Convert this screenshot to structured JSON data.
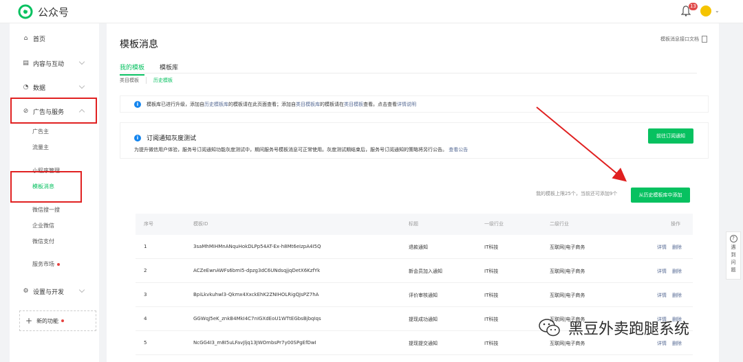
{
  "topbar": {
    "app_name": "公众号",
    "bell_badge": "13"
  },
  "sidebar": {
    "items": [
      {
        "label": "首页",
        "icon": "home-icon"
      },
      {
        "label": "内容与互动",
        "icon": "document-icon"
      },
      {
        "label": "数据",
        "icon": "chart-icon"
      },
      {
        "label": "广告与服务",
        "icon": "compass-icon"
      },
      {
        "label": "设置与开发",
        "icon": "gear-icon"
      }
    ],
    "sub_items": {
      "ad": [
        "广告主",
        "流量主"
      ],
      "service": [
        "小程序管理",
        "模板消息",
        "微信搜一搜",
        "企业微信",
        "微信支付"
      ],
      "market": "服务市场"
    },
    "new_feature": "新的功能"
  },
  "main": {
    "title": "模板消息",
    "doc_link": "模板消息接口文档",
    "tabs": [
      "我的模板",
      "模板库"
    ],
    "subtabs": [
      "类目模板",
      "历史模板"
    ],
    "notice1": {
      "t1": "模板库已进行升级，添加自",
      "l1": "历史模板库",
      "t2": "的模板请在此页面查看；添加自",
      "l2": "类目模板库",
      "t3": "的模板请在",
      "l3": "类目模板",
      "t4": "查看。点击查看",
      "l4": "详情说明"
    },
    "notice2": {
      "title": "订阅通知灰度测试",
      "desc": "为提升微信用户体验，服务号订阅通知功能灰度测试中，期间服务号模板消息可正常使用。灰度测试期结束后，服务号订阅通知的策略将另行公告。",
      "link": "查看公告",
      "button": "前往订阅通知"
    },
    "quota_text": "我的模板上限25个，当前还可添加9个",
    "add_button": "从历史模板库中添加",
    "table": {
      "headers": [
        "序号",
        "模板ID",
        "标题",
        "一级行业",
        "二级行业",
        "操作"
      ],
      "rows": [
        {
          "no": "1",
          "id": "3saMhMIHMnANquHokDLPp54AT-Ex-h8Mt6eIzpA4I5Q",
          "title": "退款通知",
          "ind1": "IT科技",
          "ind2": "互联网|电子商务",
          "op1": "详情",
          "op2": "删除"
        },
        {
          "no": "2",
          "id": "ACZeEwnAWFs6bmI5-dpzg3dC6UNdsqjjqDetX6KzfYk",
          "title": "新会员加入通知",
          "ind1": "IT科技",
          "ind2": "互联网|电子商务",
          "op1": "详情",
          "op2": "删除"
        },
        {
          "no": "3",
          "id": "BpiLkvkuhwl3-Qkmx4XxckEhK2ZNIHOLRigQJsPZ7hA",
          "title": "评价审核通知",
          "ind1": "IT科技",
          "ind2": "互联网|电子商务",
          "op1": "详情",
          "op2": "删除"
        },
        {
          "no": "4",
          "id": "GGWqJ5eK_znkB4MkI4C7nIGXdEoU1WTtEGbsBjbqIqs",
          "title": "提现成功通知",
          "ind1": "IT科技",
          "ind2": "互联网|电子商务",
          "op1": "详情",
          "op2": "删除"
        },
        {
          "no": "5",
          "id": "NcGG4I3_m8I5uLFavJljq13JWOmbsPr7y00SPgEfDwI",
          "title": "提现提交通知",
          "ind1": "IT科技",
          "ind2": "互联网|电子商务",
          "op1": "详情",
          "op2": "删除"
        }
      ]
    }
  },
  "help": {
    "chars": [
      "遇",
      "到",
      "问",
      "题"
    ]
  },
  "watermark": "黑豆外卖跑腿系统",
  "colors": {
    "accent": "#07c160",
    "link": "#576b95",
    "annotation": "#e02020",
    "info": "#1485ee"
  }
}
